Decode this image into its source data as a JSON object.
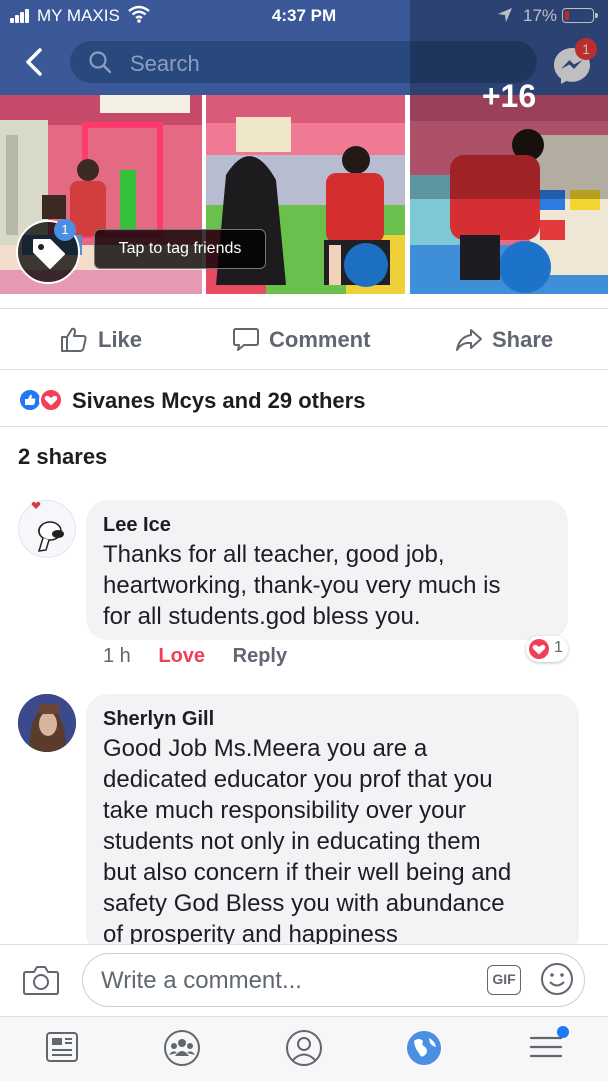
{
  "status_bar": {
    "carrier": "MY MAXIS",
    "time": "4:37 PM",
    "battery": "17%",
    "battery_level": 0.17
  },
  "header": {
    "search_placeholder": "Search",
    "messenger_badge": "1"
  },
  "photos": {
    "more_count": "+16",
    "tag_badge": "1",
    "tag_tooltip": "Tap to tag friends"
  },
  "actions": {
    "like": "Like",
    "comment": "Comment",
    "share": "Share"
  },
  "reactions": {
    "summary": "Sivanes Mcys and 29 others"
  },
  "shares": "2 shares",
  "comments": [
    {
      "author": "Lee Ice",
      "lines": [
        "Thanks for all teacher, good job,",
        "heartworking, thank-you very much is",
        "for all students.god bless you."
      ],
      "time": "1 h",
      "love": "Love",
      "reply": "Reply",
      "reaction_count": "1"
    },
    {
      "author": "Sherlyn Gill",
      "lines": [
        "Good Job Ms.Meera you are a",
        "dedicated educator you prof that you",
        "take much responsibility over your",
        "students not only in educating them",
        "but also concern if their well being and",
        "safety God Bless you with abundance",
        "of prosperity and happiness"
      ]
    }
  ],
  "composer": {
    "placeholder": "Write a comment...",
    "gif": "GIF"
  },
  "colors": {
    "brand": "#3b5998",
    "like_blue": "#2078f4",
    "love_red": "#f33e58"
  }
}
